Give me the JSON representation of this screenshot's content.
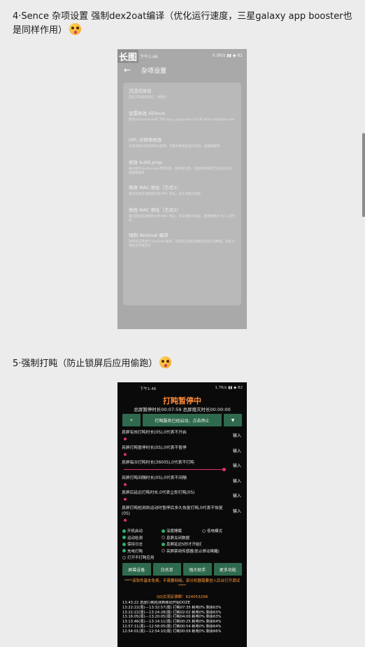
{
  "captions": {
    "first": "4·Sence 杂项设置 强制dex2oat编译（优化运行速度，三星galaxy app booster也是同样作用）",
    "second": "5·强制打盹（防止锁屏后应用偷跑）"
  },
  "phone1": {
    "stamp": "长图",
    "status_time": "下午1:46",
    "status_right": "0.0K/s ▮▮ ◆ 82",
    "title": "杂项设置",
    "items": [
      {
        "title": "沉浸式体验",
        "desc": "开启沉浸式状态栏、导航栏"
      },
      {
        "title": "设置修改 SElinux",
        "desc": "修改/data/misc/wifi 下的 wpa_supplicant.conf 和 WifiConfigStore.xml"
      },
      {
        "title": "OPL 分辨率修改",
        "desc": "仅支持部分机型修改分辨率，可能导致系统显示异常，请谨慎使用"
      },
      {
        "title": "修改 build.prop",
        "desc": "通过修改 build.prop 改变机型、版本等信息，可能导致系统无法正常启动，请谨慎操作"
      },
      {
        "title": "修改 MAC 地址（方式1）",
        "desc": "重启后会自动恢复为原 MAC 地址，仅支持部分机型"
      },
      {
        "title": "修改 MAC 地址（方式2）",
        "desc": "重启后会自动恢复为原 MAC 地址，仅支持部分机型，且需要重启 Wi-Fi 后生效"
      },
      {
        "title": "强制 dex2oat 编译",
        "desc": "对所有应用进行 dex2oat 编译，可提升应用启动速度及运行流畅度，但会占用较多存储空间"
      }
    ]
  },
  "phone2": {
    "status_time": "下午1:46",
    "status_right": "1.7K/s ▮▮ ◆ 82",
    "title": "打盹暂停中",
    "subtitle": "总屏暂停时长00:07:59 总屏熄灭时长00:00:00",
    "btn_plus": "+",
    "btn_status": "打盹服务已经启动，点击停止",
    "btn_menu": "▼",
    "rows": [
      {
        "label": "息屏有效打盹时长(0S),0代表不开启",
        "input": "输入"
      },
      {
        "label": "亮屏打盹暂停时长(0S),0代表不暂停",
        "input": "输入"
      },
      {
        "label": "息屏每次打盹时长(3600S),0代表不打盹",
        "input": "输入"
      },
      {
        "label": "亮屏打盹间隔时长(0S),0代表不间隔",
        "input": "输入"
      },
      {
        "label": "息屏后延迟打盹时长,0代表立即打盹(0S)",
        "input": "输入"
      },
      {
        "label": "息屏打盹检测到运动时暂停后多久恢复打盹,0代表不恢复(0S)",
        "input": "输入"
      }
    ],
    "checks": [
      {
        "label": "开机启动",
        "on": true
      },
      {
        "label": "深度睡眠",
        "on": true
      },
      {
        "label": "低电模式",
        "on": false
      },
      {
        "label": "运动检测",
        "on": true
      },
      {
        "label": "息屏关闭数据",
        "on": false
      },
      {
        "label": "",
        "on": false
      },
      {
        "label": "保持日志",
        "on": true
      },
      {
        "label": "息屏延迟5秒才开始打盹",
        "on": true
      },
      {
        "label": "",
        "on": false
      },
      {
        "label": "充电打盹",
        "on": true
      },
      {
        "label": "亮屏禁用传感器(防止移动唤醒)",
        "on": false
      },
      {
        "label": "",
        "on": false
      },
      {
        "label": "打开不打盹应用",
        "on": false
      }
    ],
    "buttons": [
      "屏幕设备",
      "白名单",
      "强大助手",
      "更多功能"
    ],
    "notice": "****该软件基本免费，不需要网络。部分机器需要进入后台打开调试****",
    "qq": "QQ交流反馈群：624053298",
    "log": [
      "13:43:22 息屏打盹检测到移动开始DOZE",
      "13:22:22(周)---13:32:57(周) 打盹07:35 耗电0% 剩余63%",
      "13:22:22(周)---13:24:28(周) 打盹02:02 耗电0% 剩余63%",
      "13:16:05(周)---13:20:05(周) 打盹04:00 耗电0% 剩余63%",
      "13:13:46(周)---13:14:11(周) 打盹00:25 耗电0% 剩余64%",
      "12:57:11(周)---12:58:05(周) 打盹00:54 耗电0% 剩余64%",
      "12:54:01(周)---12:54:10(周) 打盹00:09 耗电0% 剩余66%"
    ]
  },
  "colors": {
    "accent_orange": "#ff8a3a",
    "button_green": "#2f6a4e",
    "slider_pink": "#e0306a"
  }
}
